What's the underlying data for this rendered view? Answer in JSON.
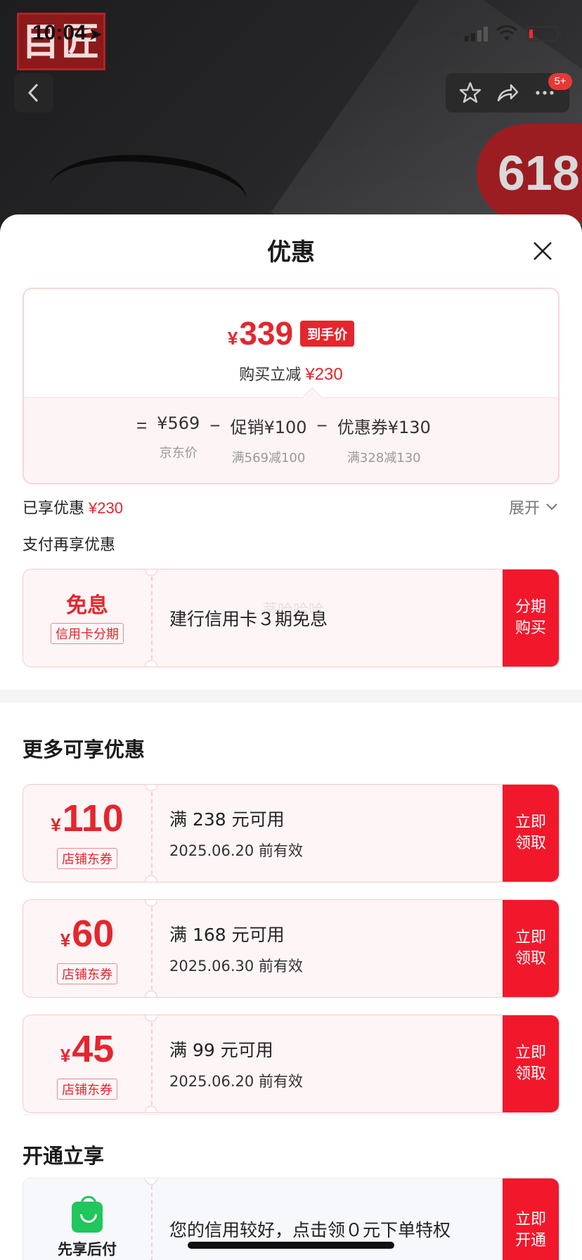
{
  "status_bar": {
    "time": "10:04"
  },
  "top_bar": {
    "badge_count": "5+",
    "promo_text": "618",
    "logo_text": "目匠"
  },
  "sheet": {
    "title": "优惠",
    "summary": {
      "final_price_yen": "¥",
      "final_price": "339",
      "final_price_tag": "到手价",
      "reduce_label": "购买立减",
      "reduce_amount": "¥230",
      "formula": {
        "eq": "=",
        "minus": "−",
        "items": [
          {
            "main": "¥569",
            "sub": "京东价"
          },
          {
            "main": "促销¥100",
            "sub": "满569减100"
          },
          {
            "main": "优惠券¥130",
            "sub": "满328减130"
          }
        ]
      }
    },
    "enjoyed_label": "已享优惠",
    "enjoyed_amount": "¥230",
    "expand_label": "展开",
    "pay_more_label": "支付再享优惠",
    "installment": {
      "title": "免息",
      "tag": "信用卡分期",
      "desc": "建行信用卡３期免息",
      "button": "分期\n购买",
      "watermark": "蒂哈哈哈"
    },
    "more_title": "更多可享优惠",
    "coupons": [
      {
        "yen": "¥",
        "amount": "110",
        "tag": "店铺东券",
        "condition": "满 238 元可用",
        "expire": "2025.06.20 前有效",
        "button": "立即\n领取"
      },
      {
        "yen": "¥",
        "amount": "60",
        "tag": "店铺东券",
        "condition": "满 168 元可用",
        "expire": "2025.06.30 前有效",
        "button": "立即\n领取"
      },
      {
        "yen": "¥",
        "amount": "45",
        "tag": "店铺东券",
        "condition": "满 99 元可用",
        "expire": "2025.06.20 前有效",
        "button": "立即\n领取"
      }
    ],
    "open_title": "开通立享",
    "credit": {
      "label": "先享后付",
      "desc": "您的信用较好，点击领０元下单特权",
      "button": "立即\n开通"
    }
  },
  "colors": {
    "accent": "#e4262e",
    "button_red": "#f2182c",
    "green": "#21c65c"
  }
}
